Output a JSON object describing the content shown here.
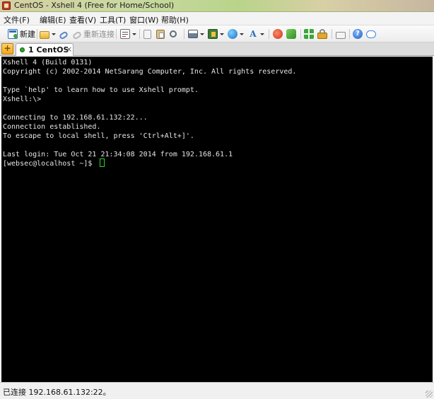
{
  "window": {
    "title": "CentOS - Xshell 4 (Free for Home/School)"
  },
  "menu": {
    "items": [
      "文件(F)",
      "编辑(E)",
      "查看(V)",
      "工具(T)",
      "窗口(W)",
      "帮助(H)"
    ]
  },
  "toolbar": {
    "new_label": "新建",
    "reconnect_label": "重新连接"
  },
  "tabs": {
    "active_label": "1 CentOS",
    "add_label": "+",
    "close_label": "×"
  },
  "terminal": {
    "lines": [
      "Xshell 4 (Build 0131)",
      "Copyright (c) 2002-2014 NetSarang Computer, Inc. All rights reserved.",
      "",
      "Type `help' to learn how to use Xshell prompt.",
      "Xshell:\\>",
      "",
      "Connecting to 192.168.61.132:22...",
      "Connection established.",
      "To escape to local shell, press 'Ctrl+Alt+]'.",
      "",
      "Last login: Tue Oct 21 21:34:08 2014 from 192.168.61.1",
      "[websec@localhost ~]$ "
    ]
  },
  "status": {
    "text": "已连接 192.168.61.132:22。"
  },
  "colors": {
    "terminal_bg": "#000000",
    "terminal_fg": "#e6e6e6",
    "cursor": "#31d331",
    "session_active": "#27a827"
  }
}
